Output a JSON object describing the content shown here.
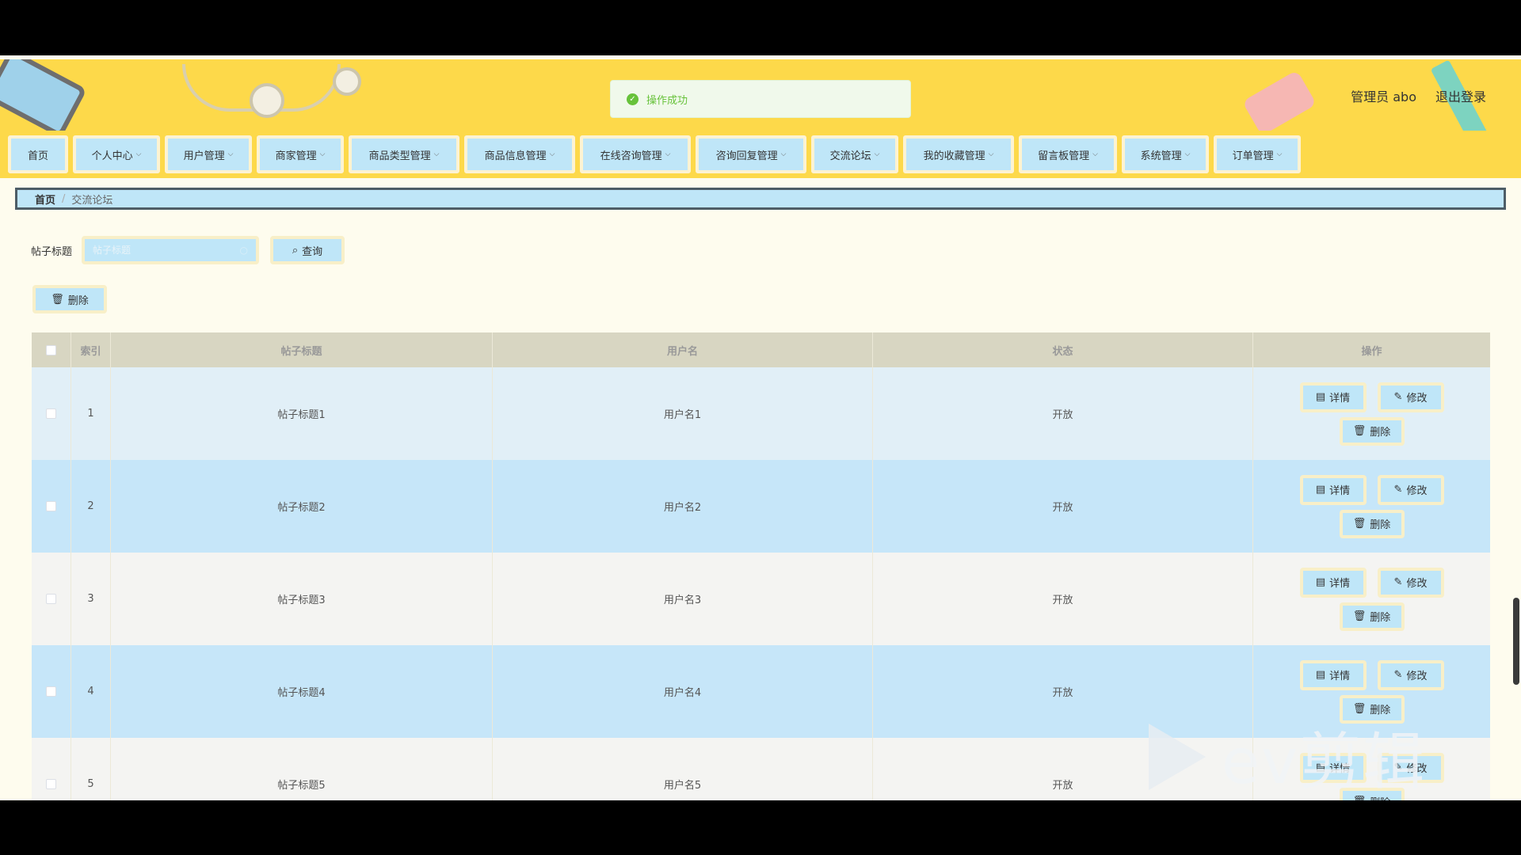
{
  "header": {
    "toast": "操作成功",
    "user_label": "管理员 abo",
    "logout_label": "退出登录"
  },
  "nav": [
    {
      "label": "首页",
      "dropdown": false
    },
    {
      "label": "个人中心",
      "dropdown": true
    },
    {
      "label": "用户管理",
      "dropdown": true
    },
    {
      "label": "商家管理",
      "dropdown": true
    },
    {
      "label": "商品类型管理",
      "dropdown": true
    },
    {
      "label": "商品信息管理",
      "dropdown": true
    },
    {
      "label": "在线咨询管理",
      "dropdown": true
    },
    {
      "label": "咨询回复管理",
      "dropdown": true
    },
    {
      "label": "交流论坛",
      "dropdown": true
    },
    {
      "label": "我的收藏管理",
      "dropdown": true
    },
    {
      "label": "留言板管理",
      "dropdown": true
    },
    {
      "label": "系统管理",
      "dropdown": true
    },
    {
      "label": "订单管理",
      "dropdown": true
    }
  ],
  "breadcrumb": {
    "home": "首页",
    "separator": "/",
    "current": "交流论坛"
  },
  "search": {
    "label": "帖子标题",
    "placeholder": "帖子标题",
    "query_label": "查询"
  },
  "bulk_delete_label": "删除",
  "table": {
    "headers": {
      "index": "索引",
      "title": "帖子标题",
      "user": "用户名",
      "status": "状态",
      "ops": "操作"
    },
    "rows": [
      {
        "index": "1",
        "title": "帖子标题1",
        "user": "用户名1",
        "status": "开放"
      },
      {
        "index": "2",
        "title": "帖子标题2",
        "user": "用户名2",
        "status": "开放"
      },
      {
        "index": "3",
        "title": "帖子标题3",
        "user": "用户名3",
        "status": "开放"
      },
      {
        "index": "4",
        "title": "帖子标题4",
        "user": "用户名4",
        "status": "开放"
      },
      {
        "index": "5",
        "title": "帖子标题5",
        "user": "用户名5",
        "status": "开放"
      }
    ],
    "op_labels": {
      "detail": "详情",
      "edit": "修改",
      "delete": "删除"
    }
  },
  "watermark": "ev剪辑",
  "colors": {
    "header": "#fdd94a",
    "button": "#bfe6f8",
    "success": "#67c23a"
  }
}
